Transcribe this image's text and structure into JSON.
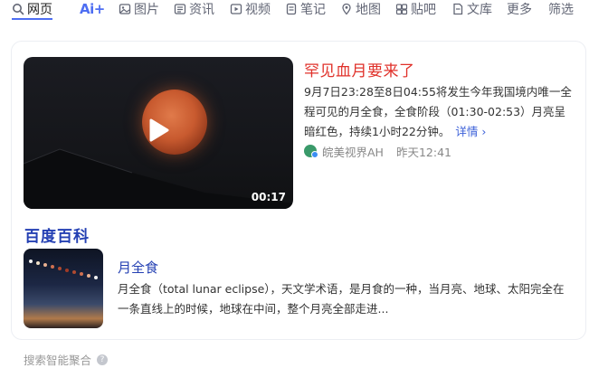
{
  "tabs": [
    {
      "label": "网页",
      "icon": "search-icon",
      "active": true
    },
    {
      "label": "Ai+",
      "icon": "ai-icon",
      "active": false
    },
    {
      "label": "图片",
      "icon": "image-icon",
      "active": false
    },
    {
      "label": "资讯",
      "icon": "news-icon",
      "active": false
    },
    {
      "label": "视频",
      "icon": "video-icon",
      "active": false
    },
    {
      "label": "笔记",
      "icon": "note-icon",
      "active": false
    },
    {
      "label": "地图",
      "icon": "map-icon",
      "active": false
    },
    {
      "label": "贴吧",
      "icon": "tieba-icon",
      "active": false
    },
    {
      "label": "文库",
      "icon": "wenku-icon",
      "active": false
    },
    {
      "label": "更多",
      "icon": "",
      "active": false
    },
    {
      "label": "筛选",
      "icon": "",
      "active": false
    }
  ],
  "video_result": {
    "title": "罕见血月要来了",
    "description": "9月7日23:28至8日04:55将发生今年我国境内唯一全程可见的月全食，全食阶段（01:30-02:53）月亮呈暗红色，持续1小时22分钟。",
    "more_label": "详情 ›",
    "duration": "00:17",
    "source": "皖美视界AH",
    "time": "昨天12:41"
  },
  "baike": {
    "heading": "百度百科",
    "term": "月全食",
    "description": "月全食（total lunar eclipse），天文学术语，是月食的一种，当月亮、地球、太阳完全在一条直线上的时候，地球在中间，整个月亮全部走进..."
  },
  "footer": {
    "label": "搜索智能聚合"
  },
  "colors": {
    "accent": "#4e6ef2",
    "title_red": "#e0312a",
    "link_blue": "#2440b3"
  }
}
